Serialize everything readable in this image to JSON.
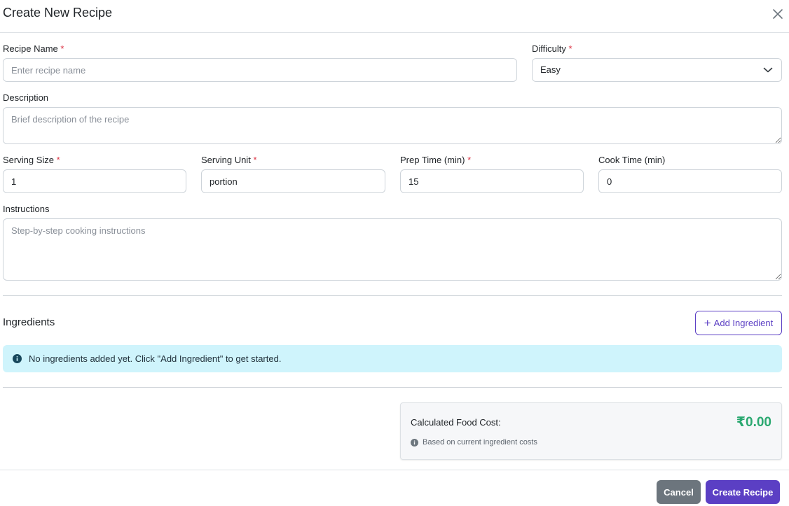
{
  "modal": {
    "title": "Create New Recipe"
  },
  "form": {
    "recipe_name": {
      "label": "Recipe Name",
      "required_mark": "*",
      "placeholder": "Enter recipe name",
      "value": ""
    },
    "difficulty": {
      "label": "Difficulty",
      "required_mark": "*",
      "selected": "Easy"
    },
    "description": {
      "label": "Description",
      "placeholder": "Brief description of the recipe",
      "value": ""
    },
    "serving_size": {
      "label": "Serving Size",
      "required_mark": "*",
      "value": "1"
    },
    "serving_unit": {
      "label": "Serving Unit",
      "required_mark": "*",
      "value": "portion"
    },
    "prep_time": {
      "label": "Prep Time (min)",
      "required_mark": "*",
      "value": "15"
    },
    "cook_time": {
      "label": "Cook Time (min)",
      "value": "0"
    },
    "instructions": {
      "label": "Instructions",
      "placeholder": "Step-by-step cooking instructions",
      "value": ""
    }
  },
  "ingredients": {
    "title": "Ingredients",
    "add_button": "Add Ingredient",
    "empty_message": "No ingredients added yet. Click \"Add Ingredient\" to get started."
  },
  "cost": {
    "label": "Calculated Food Cost:",
    "value": "₹0.00",
    "note": "Based on current ingredient costs"
  },
  "footer": {
    "cancel": "Cancel",
    "create": "Create Recipe"
  },
  "colors": {
    "primary": "#5b3fc4",
    "required": "#dc3545",
    "cost_value": "#2aa870",
    "alert_bg": "#cff4fc",
    "secondary_button": "#6c757d"
  },
  "icons": {
    "close": "close-icon",
    "dropdown": "chevron-down-icon",
    "plus": "plus-icon",
    "info": "info-icon"
  }
}
